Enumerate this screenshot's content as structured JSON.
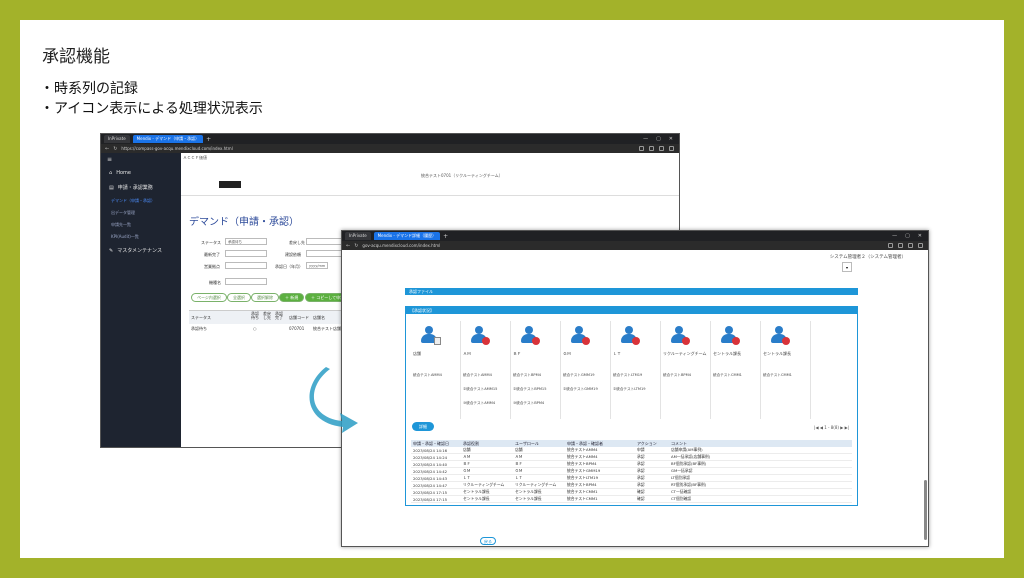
{
  "slide": {
    "title": "承認機能",
    "bullets": [
      "・時系列の記録",
      "・アイコン表示による処理状況表示"
    ]
  },
  "win1": {
    "tabs": [
      "InPrivate",
      "Mendix - デマンド（申請・承認）"
    ],
    "url": "https://compass-gov-acqu.mendixcloud.com/index.html",
    "sidebar": {
      "home": "Home",
      "section": "申請・承認業務",
      "subs": [
        "デマンド（申請・承認）",
        "出データ管理",
        "申請先一覧",
        "KPI(Audit)一覧"
      ],
      "maint": "マスタメンテナンス"
    },
    "breadcrumb": "ＡＣＣＦ価値",
    "user": "統合テスト0701（リクルーティングチーム）",
    "heading": "デマンド（申請・承認）",
    "fields": {
      "status_label": "ステータス",
      "status_value": "承認待ち",
      "request_label": "差戻し先",
      "approve_label": "最新完了",
      "category_label": "建設依頼",
      "sales_label": "営業拠点",
      "date_label": "承認日（年月）",
      "date_placeholder": "yyyy/mm",
      "model_label": "機種名"
    },
    "buttons": [
      "ページ内選択",
      "全選択",
      "選択解除",
      "＋ 新規",
      "＋ コピーして申請"
    ],
    "table": {
      "headers": [
        "ステータス",
        "承認待ち",
        "差戻し先",
        "承認完了",
        "店舗コード",
        "店舗名"
      ],
      "row": [
        "承認待ち",
        "○",
        "",
        "",
        "070701",
        "統合テスト店舗"
      ]
    }
  },
  "win2": {
    "tabs": [
      "InPrivate",
      "Mendix - デマンド詳細（履歴）"
    ],
    "url": "gov-acqu.mendixcloud.com/index.html",
    "user": "システム管理者２（システム管理者）",
    "top_bar": "承認ファイル",
    "panel_title": "【承認状況】",
    "icons": [
      {
        "label": "店舗",
        "users": [
          "統合テストAMM4"
        ]
      },
      {
        "label": "ＡＭ",
        "users": [
          "統合テストAMM4",
          "②統合テストAMM15",
          "③統合テストAMM4"
        ]
      },
      {
        "label": "ＢＦ",
        "users": [
          "統合テストBPM4",
          "②統合テストBPM15",
          "③統合テストBPM4"
        ]
      },
      {
        "label": "ＧＭ",
        "users": [
          "統合テストGMM19",
          "②統合テストGMM19"
        ]
      },
      {
        "label": "ＬＴ",
        "users": [
          "統合テストLTM19",
          "②統合テストLTM19"
        ]
      },
      {
        "label": "リクルーティングチーム",
        "users": [
          "統合テストBPM4"
        ]
      },
      {
        "label": "セントラル課長",
        "users": [
          "統合テストCMM1"
        ]
      },
      {
        "label": "セントラル課長",
        "users": [
          "統合テストCMM1"
        ]
      }
    ],
    "detail_button": "詳細",
    "pager": "1 - 8(8)",
    "history": {
      "headers": [
        "申請・承認・確認日",
        "承認役割",
        "ユーザロール",
        "申請・承認・確認者",
        "アクション",
        "コメント"
      ],
      "rows": [
        [
          "2023/08/24 14:16",
          "店舗",
          "店舗",
          "統合テストAMM4",
          "申請",
          "店舗申請(AM事例)"
        ],
        [
          "2023/08/24 14:24",
          "ＡＭ",
          "ＡＭ",
          "統合テストAMM4",
          "承認",
          "AM一括承認(店舗事例)"
        ],
        [
          "2023/08/24 14:40",
          "ＢＦ",
          "ＢＦ",
          "統合テストBPM4",
          "承認",
          "BF個別承認(BF事例)"
        ],
        [
          "2023/08/24 14:42",
          "ＧＭ",
          "ＧＭ",
          "統合テストGMM19",
          "承認",
          "GM一括承認"
        ],
        [
          "2023/08/24 14:43",
          "ＬＴ",
          "ＬＴ",
          "統合テストLTM19",
          "承認",
          "LT個別承認"
        ],
        [
          "2023/08/24 14:47",
          "リクルーティングチーム",
          "リクルーティングチーム",
          "統合テストBPM4",
          "承認",
          "RT個別承認(BF事例)"
        ],
        [
          "2023/08/24 17:15",
          "セントラル課長",
          "セントラル課長",
          "統合テストCMM1",
          "確認",
          "CT一括確認"
        ],
        [
          "2023/08/24 17:15",
          "セントラル課長",
          "セントラル課長",
          "統合テストCMM1",
          "確認",
          "CT個別確認"
        ]
      ]
    },
    "back_button": "戻る"
  },
  "colors": {
    "border": "#a3b22a",
    "accent": "#1e96d8",
    "sidebar": "#1e2430",
    "green": "#5cb040",
    "arrow": "#2a9cc4"
  }
}
